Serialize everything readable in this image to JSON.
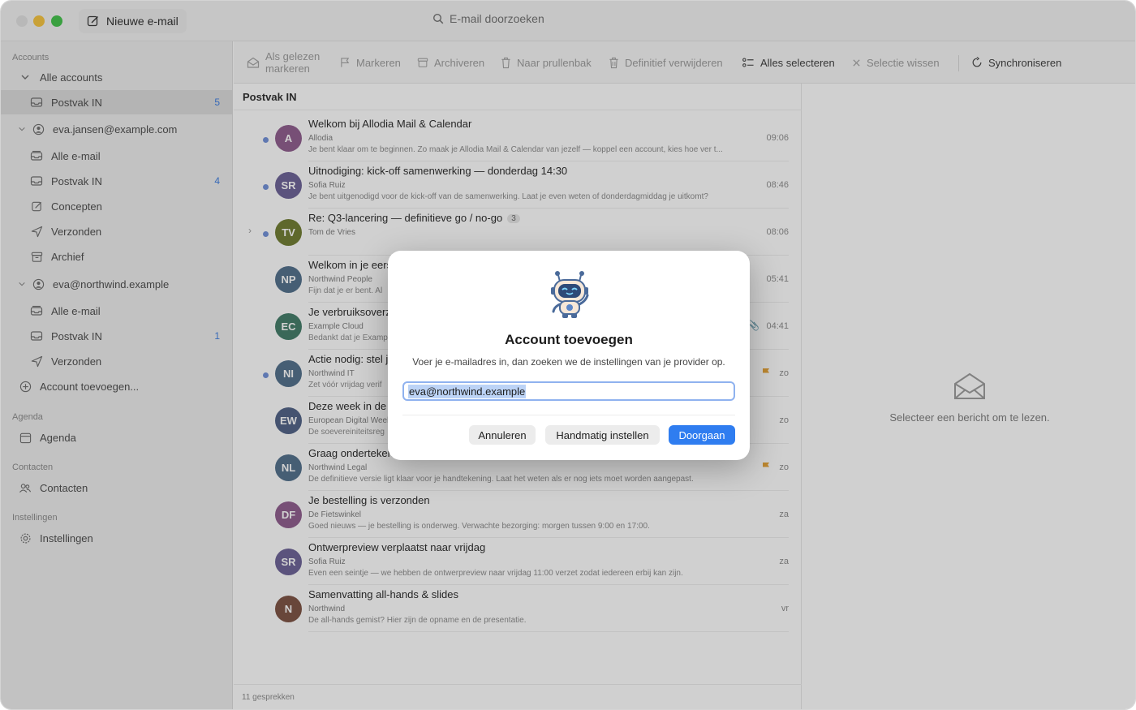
{
  "titlebar": {
    "compose_label": "Nieuwe e-mail",
    "search_placeholder": "E-mail doorzoeken"
  },
  "sidebar": {
    "sections": {
      "accounts": "Accounts",
      "agenda": "Agenda",
      "contacts": "Contacten",
      "settings": "Instellingen"
    },
    "all_accounts": "Alle accounts",
    "unified_inbox": {
      "label": "Postvak IN",
      "count": "5"
    },
    "account1": {
      "name": "eva.jansen@example.com",
      "items": [
        {
          "label": "Alle e-mail",
          "count": ""
        },
        {
          "label": "Postvak IN",
          "count": "4"
        },
        {
          "label": "Concepten",
          "count": ""
        },
        {
          "label": "Verzonden",
          "count": ""
        },
        {
          "label": "Archief",
          "count": ""
        }
      ]
    },
    "account2": {
      "name": "eva@northwind.example",
      "items": [
        {
          "label": "Alle e-mail",
          "count": ""
        },
        {
          "label": "Postvak IN",
          "count": "1"
        },
        {
          "label": "Verzonden",
          "count": ""
        }
      ]
    },
    "add_account": "Account toevoegen...",
    "agenda_item": "Agenda",
    "contacts_item": "Contacten",
    "settings_item": "Instellingen"
  },
  "toolbar": {
    "mark_read": "Als gelezen markeren",
    "flag": "Markeren",
    "archive": "Archiveren",
    "trash": "Naar prullenbak",
    "delete": "Definitief verwijderen",
    "select_all": "Alles selecteren",
    "clear_selection": "Selectie wissen",
    "sync": "Synchroniseren"
  },
  "list": {
    "title": "Postvak IN",
    "footer": "11 gesprekken",
    "messages": [
      {
        "initials": "A",
        "color": "#8d5a8c",
        "subject": "Welkom bij Allodia Mail & Calendar",
        "sender": "Allodia",
        "preview": "Je bent klaar om te beginnen. Zo maak je Allodia Mail & Calendar van jezelf — koppel een account, kies hoe ver t...",
        "time": "09:06",
        "unread": true
      },
      {
        "initials": "SR",
        "color": "#6a5f95",
        "subject": "Uitnodiging: kick-off samenwerking — donderdag 14:30",
        "sender": "Sofia Ruiz",
        "preview": "Je bent uitgenodigd voor de kick-off van de samenwerking. Laat je even weten of donderdagmiddag je uitkomt?",
        "time": "08:46",
        "unread": true
      },
      {
        "initials": "TV",
        "color": "#6e7a2e",
        "subject": "Re: Q3-lancering — definitieve go / no-go",
        "thread": "3",
        "sender": "Tom de Vries",
        "preview": "",
        "time": "08:06",
        "unread": true
      },
      {
        "initials": "NP",
        "color": "#4f6d8a",
        "subject": "Welkom in je eerste week",
        "sender": "Northwind People",
        "preview": "Fijn dat je er bent. Al",
        "time": "05:41",
        "unread": false
      },
      {
        "initials": "EC",
        "color": "#3f7a66",
        "subject": "Je verbruiksoverzicht",
        "sender": "Example Cloud",
        "preview": "Bedankt dat je Example Cloud gebruikt",
        "time": "04:41",
        "unread": false,
        "attachment": true
      },
      {
        "initials": "NI",
        "color": "#4f6d8a",
        "subject": "Actie nodig: stel je wachtwoord in",
        "sender": "Northwind IT",
        "preview": "Zet vóór vrijdag verif",
        "time": "zo",
        "unread": true,
        "flag": true
      },
      {
        "initials": "EW",
        "color": "#4d5f84",
        "subject": "Deze week in de",
        "sender": "European Digital Weekly",
        "preview": "De soevereiniteitsreg",
        "time": "zo",
        "unread": false
      },
      {
        "initials": "NL",
        "color": "#4f6d8a",
        "subject": "Graag ondertekenen",
        "sender": "Northwind Legal",
        "preview": "De definitieve versie ligt klaar voor je handtekening. Laat het weten als er nog iets moet worden aangepast.",
        "time": "zo",
        "unread": false,
        "flag": true
      },
      {
        "initials": "DF",
        "color": "#8d5a8c",
        "subject": "Je bestelling is verzonden",
        "sender": "De Fietswinkel",
        "preview": "Goed nieuws — je bestelling is onderweg. Verwachte bezorging: morgen tussen 9:00 en 17:00.",
        "time": "za",
        "unread": false
      },
      {
        "initials": "SR",
        "color": "#6a5f95",
        "subject": "Ontwerpreview verplaatst naar vrijdag",
        "sender": "Sofia Ruiz",
        "preview": "Even een seintje — we hebben de ontwerpreview naar vrijdag 11:00 verzet zodat iedereen erbij kan zijn.",
        "time": "za",
        "unread": false
      },
      {
        "initials": "N",
        "color": "#7a4f3f",
        "subject": "Samenvatting all-hands & slides",
        "sender": "Northwind",
        "preview": "De all-hands gemist? Hier zijn de opname en de presentatie.",
        "time": "vr",
        "unread": false
      }
    ]
  },
  "reading": {
    "empty_text": "Selecteer een bericht om te lezen."
  },
  "dialog": {
    "title": "Account toevoegen",
    "subtitle": "Voer je e-mailadres in, dan zoeken we de instellingen van je provider op.",
    "email_value": "eva@northwind.example",
    "cancel": "Annuleren",
    "manual": "Handmatig instellen",
    "continue": "Doorgaan"
  }
}
